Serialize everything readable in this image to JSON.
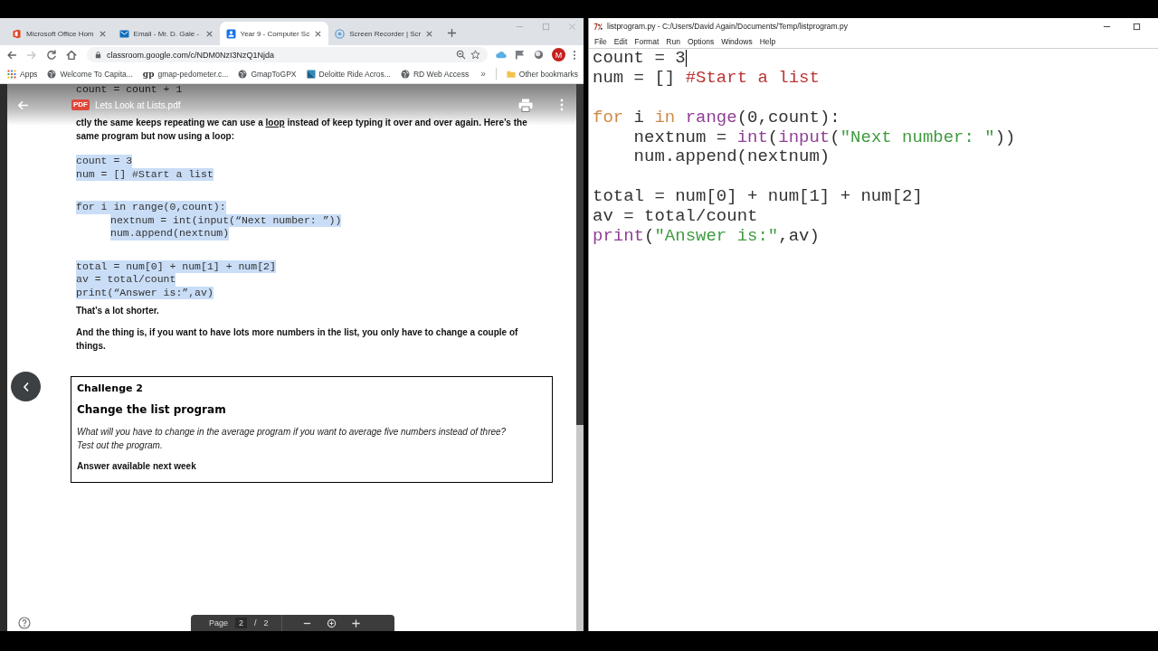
{
  "browser": {
    "tabs": [
      {
        "title": "Microsoft Office Hom",
        "kind": "office",
        "selected": false
      },
      {
        "title": "Email - Mr. D. Gale -",
        "kind": "mail",
        "selected": false
      },
      {
        "title": "Year 9 - Computer Sc",
        "kind": "classroom",
        "selected": true
      },
      {
        "title": "Screen Recorder | Scr",
        "kind": "recorder",
        "selected": false
      }
    ],
    "nav_buttons": [
      {
        "kind": "back",
        "disabled": false
      },
      {
        "kind": "forward",
        "disabled": true
      },
      {
        "kind": "reload",
        "disabled": false
      },
      {
        "kind": "home",
        "disabled": false
      }
    ],
    "address_bar": {
      "url": "classroom.google.com/c/NDM0NzI3NzQ1Njda"
    },
    "profile": {
      "initial": "M"
    },
    "bookmarks": [
      {
        "label": "Apps",
        "kind": "apps"
      },
      {
        "label": "Welcome To Capita...",
        "kind": "globe"
      },
      {
        "label": "gmap-pedometer.c...",
        "kind": "letters",
        "icon_text": "gp"
      },
      {
        "label": "GmapToGPX",
        "kind": "globe"
      },
      {
        "label": "Deloitte Ride Acros...",
        "kind": "deloitte"
      },
      {
        "label": "RD Web Access",
        "kind": "globe"
      }
    ],
    "bookmarks_overflow": "»",
    "other_bookmarks": {
      "label": "Other bookmarks"
    }
  },
  "pdf_viewer": {
    "badge": "PDF",
    "title": "Lets Look at Lists.pdf",
    "top_code_line": "count = count + 1",
    "intro": {
      "before": "ctly the same keeps repeating we can use a ",
      "underlined": "loop",
      "after": " instead of keep typing it over and over again. Here’s the same program but now using a loop:"
    },
    "code_blocks": [
      {
        "lines": [
          {
            "text": "count = 3",
            "selected": true
          },
          {
            "text": "num = [] #Start a list",
            "selected": true
          }
        ]
      },
      {
        "lines": [
          {
            "text": "for i in range(0,count):",
            "selected": true,
            "children": [
              {
                "text": "nextnum = int(input(“Next number: ”))",
                "selected": true
              },
              {
                "text": "num.append(nextnum)",
                "selected": true
              }
            ]
          }
        ]
      },
      {
        "lines": [
          {
            "text": "total = num[0] + num[1] + num[2]",
            "selected": true
          },
          {
            "text": "av = total/count",
            "selected": true
          },
          {
            "text": "print(“Answer is:”,av)",
            "selected": true
          }
        ]
      }
    ],
    "remark": "That’s a lot shorter.",
    "paragraph": "And the thing is, if you want to have lots more numbers in the list, you only have to change a couple of things.",
    "challenge": {
      "heading": "Challenge 2",
      "title": "Change the list program",
      "question": "What will you have to change in the average program if you want to average five numbers instead of three? Test out the program.",
      "answer_note": "Answer available next week"
    },
    "page_controls": {
      "label": "Page",
      "current": "2",
      "separator": "/",
      "total": "2"
    }
  },
  "editor": {
    "title": "listprogram.py - C:/Users/David Again/Documents/Temp/listprogram.py",
    "menu": [
      "File",
      "Edit",
      "Format",
      "Run",
      "Options",
      "Windows",
      "Help"
    ],
    "blocks": [
      {
        "lines": [
          {
            "tokens": [
              {
                "kind": "plain",
                "text": "count = 3"
              }
            ],
            "caret": true
          },
          {
            "tokens": [
              {
                "kind": "plain",
                "text": "num = [] "
              },
              {
                "kind": "comment",
                "text": "#Start a list"
              }
            ],
            "caret": false
          }
        ]
      },
      {
        "lines": [
          {
            "tokens": [
              {
                "kind": "keyword",
                "text": "for"
              },
              {
                "kind": "plain",
                "text": " i "
              },
              {
                "kind": "keyword",
                "text": "in "
              },
              {
                "kind": "builtin",
                "text": "range"
              },
              {
                "kind": "plain",
                "text": "(0,count):"
              }
            ],
            "caret": false,
            "children": [
              {
                "tokens": [
                  {
                    "kind": "plain",
                    "text": "nextnum = "
                  },
                  {
                    "kind": "builtin",
                    "text": "int"
                  },
                  {
                    "kind": "plain",
                    "text": "("
                  },
                  {
                    "kind": "builtin",
                    "text": "input"
                  },
                  {
                    "kind": "plain",
                    "text": "("
                  },
                  {
                    "kind": "string",
                    "text": "\"Next number: \""
                  },
                  {
                    "kind": "plain",
                    "text": "))"
                  }
                ],
                "caret": false
              },
              {
                "tokens": [
                  {
                    "kind": "plain",
                    "text": "num.append(nextnum)"
                  }
                ],
                "caret": false
              }
            ]
          }
        ]
      },
      {
        "lines": [
          {
            "tokens": [
              {
                "kind": "plain",
                "text": "total = num[0] + num[1] + num[2]"
              }
            ],
            "caret": false
          },
          {
            "tokens": [
              {
                "kind": "plain",
                "text": "av = total/count"
              }
            ],
            "caret": false
          },
          {
            "tokens": [
              {
                "kind": "builtin",
                "text": "print"
              },
              {
                "kind": "plain",
                "text": "("
              },
              {
                "kind": "string",
                "text": "\"Answer is:\""
              },
              {
                "kind": "plain",
                "text": ",av)"
              }
            ],
            "caret": false
          }
        ]
      }
    ]
  }
}
